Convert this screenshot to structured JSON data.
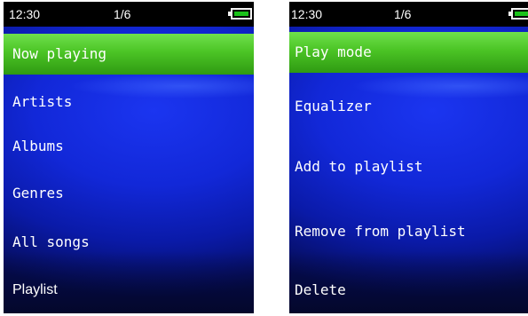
{
  "left_screen": {
    "status": {
      "time": "12:30",
      "page": "1/6"
    },
    "menu": [
      {
        "label": "Now playing",
        "selected": true
      },
      {
        "label": "Artists",
        "selected": false
      },
      {
        "label": "Albums",
        "selected": false
      },
      {
        "label": "Genres",
        "selected": false
      },
      {
        "label": "All songs",
        "selected": false
      },
      {
        "label": "Playlist",
        "selected": false
      }
    ]
  },
  "right_screen": {
    "status": {
      "time": "12:30",
      "page": "1/6"
    },
    "menu": [
      {
        "label": "Play mode",
        "selected": true
      },
      {
        "label": "Equalizer",
        "selected": false
      },
      {
        "label": "Add to playlist",
        "selected": false
      },
      {
        "label": "Remove from playlist",
        "selected": false
      },
      {
        "label": "Delete",
        "selected": false
      }
    ]
  },
  "colors": {
    "highlight": "#4bc425",
    "background": "#1228d8",
    "statusbar": "#000000",
    "battery_fill": "#1ac21a"
  },
  "icons": {
    "battery": "battery-icon"
  }
}
